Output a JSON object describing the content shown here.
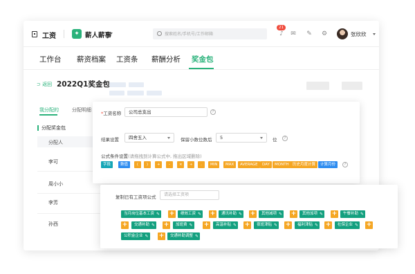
{
  "topbar": {
    "brand_title": "工资",
    "module_name": "薪人薪事",
    "search_placeholder": "搜索姓名/手机号/工作邮箱",
    "notification_count": "21",
    "user_name": "张欣欣"
  },
  "nav": {
    "tabs": [
      {
        "label": "工作台"
      },
      {
        "label": "薪资档案"
      },
      {
        "label": "工资条"
      },
      {
        "label": "薪酬分析"
      },
      {
        "label": "奖金包"
      }
    ],
    "active_tab": "奖金包"
  },
  "page": {
    "back_label": "返回",
    "title": "2022Q1奖金包"
  },
  "left_panel": {
    "subtabs": [
      {
        "label": "我分配的"
      },
      {
        "label": "分配明细"
      }
    ],
    "section_label": "分配奖金包",
    "column_header": "分配人",
    "people": [
      "李可",
      "周小小",
      "李芳",
      "孙西"
    ]
  },
  "form": {
    "salary_name_label": "工资名称",
    "salary_name_value": "公司总支出",
    "rounding_label": "结果设置",
    "rounding_value": "四舍五入",
    "decimals_label": "保留小数位数后",
    "decimals_value": "5",
    "decimals_unit": "位",
    "formula_label": "公式条件设置",
    "formula_hint": "(请拖拽到计算公式中, 拖出区域删除)",
    "tokens": [
      "字段",
      "数值",
      "(",
      ")",
      "+",
      "-",
      "×",
      "÷",
      ".",
      "MIN",
      "MAX",
      "AVERAGE",
      "DAY",
      "MONTH",
      "历史月度计算",
      "计算月份"
    ]
  },
  "copy_card": {
    "label": "复制已有工资项公式",
    "select_placeholder": "请选择工资项",
    "tags": [
      "当月岗位基本工资",
      "绩效工资",
      "通讯补助",
      "其他减项",
      "其他加项",
      "午餐补助",
      "交通补助",
      "加班费",
      "高温补贴",
      "夜班津贴",
      "福利津贴",
      "社保企业",
      "公积金企业",
      "交通补助调整"
    ]
  },
  "colors": {
    "accent": "#2ab27b",
    "token_teal": "#16a6b6",
    "token_orange": "#f5a623",
    "token_blue": "#2d8cf0",
    "tag_green": "#13a07f",
    "badge_red": "#f04b3c"
  }
}
